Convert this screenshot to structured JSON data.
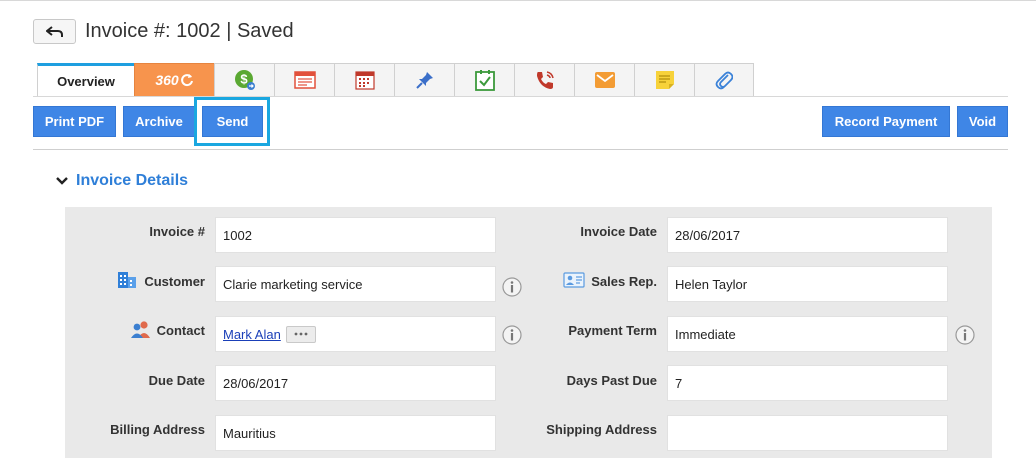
{
  "header": {
    "title": "Invoice #: 1002 | Saved",
    "back_icon": "back-arrow-icon"
  },
  "tabs": [
    {
      "label": "Overview"
    },
    {
      "icon": "360-icon",
      "label": "360"
    },
    {
      "icon": "payment-dollar-icon"
    },
    {
      "icon": "notes-list-icon"
    },
    {
      "icon": "calendar-icon"
    },
    {
      "icon": "pin-icon"
    },
    {
      "icon": "task-check-icon"
    },
    {
      "icon": "phone-call-icon"
    },
    {
      "icon": "email-icon"
    },
    {
      "icon": "sticky-note-icon"
    },
    {
      "icon": "attachment-icon"
    }
  ],
  "actions": {
    "print_pdf": "Print PDF",
    "archive": "Archive",
    "send": "Send",
    "record_payment": "Record Payment",
    "void": "Void"
  },
  "section": {
    "title": "Invoice Details"
  },
  "fields": {
    "invoice_no": {
      "label": "Invoice #",
      "value": "1002"
    },
    "invoice_date": {
      "label": "Invoice Date",
      "value": "28/06/2017"
    },
    "customer": {
      "label": "Customer",
      "value": "Clarie marketing service"
    },
    "sales_rep": {
      "label": "Sales Rep.",
      "value": "Helen Taylor"
    },
    "contact": {
      "label": "Contact",
      "value": "Mark Alan"
    },
    "payment_term": {
      "label": "Payment Term",
      "value": "Immediate"
    },
    "due_date": {
      "label": "Due Date",
      "value": "28/06/2017"
    },
    "days_past_due": {
      "label": "Days Past Due",
      "value": "7"
    },
    "billing_address": {
      "label": "Billing Address",
      "value": "Mauritius"
    },
    "shipping_address": {
      "label": "Shipping Address",
      "value": ""
    }
  },
  "colors": {
    "primary_button": "#3f86e6",
    "section_title": "#2f7fd8",
    "focus_ring": "#1aa7e0",
    "tab_360": "#f7944d"
  }
}
